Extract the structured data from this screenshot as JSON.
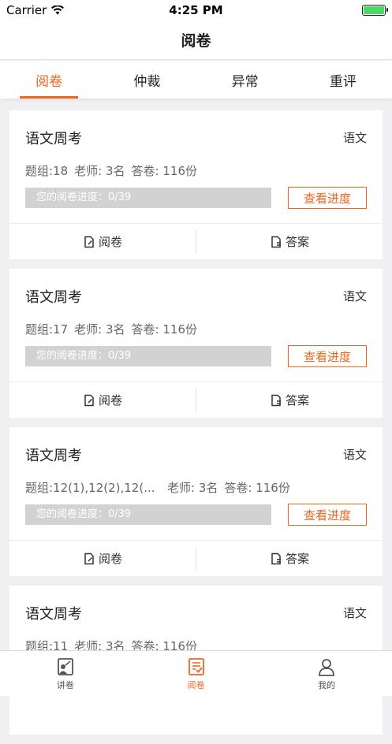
{
  "status": {
    "carrier": "Carrier",
    "time": "4:25 PM"
  },
  "nav": {
    "title": "阅卷"
  },
  "tabs": [
    {
      "label": "阅卷",
      "active": true
    },
    {
      "label": "仲裁",
      "active": false
    },
    {
      "label": "异常",
      "active": false
    },
    {
      "label": "重评",
      "active": false
    }
  ],
  "cards": [
    {
      "title": "语文周考",
      "subject": "语文",
      "group": "题组:18",
      "teachers": "老师: 3名",
      "papers": "答卷: 116份",
      "progress": "您的阅卷进度：0/39",
      "view_label": "查看进度",
      "mark_label": "阅卷",
      "answer_label": "答案"
    },
    {
      "title": "语文周考",
      "subject": "语文",
      "group": "题组:17",
      "teachers": "老师: 3名",
      "papers": "答卷: 116份",
      "progress": "您的阅卷进度：0/39",
      "view_label": "查看进度",
      "mark_label": "阅卷",
      "answer_label": "答案"
    },
    {
      "title": "语文周考",
      "subject": "语文",
      "group": "题组:12(1),12(2),12(...",
      "teachers": "老师: 3名",
      "papers": "答卷: 116份",
      "progress": "您的阅卷进度：0/39",
      "view_label": "查看进度",
      "mark_label": "阅卷",
      "answer_label": "答案"
    },
    {
      "title": "语文周考",
      "subject": "语文",
      "group": "题组:11",
      "teachers": "老师: 3名",
      "papers": "答卷: 116份",
      "progress": "",
      "view_label": "",
      "mark_label": "",
      "answer_label": ""
    }
  ],
  "bottom_tabs": [
    {
      "label": "讲卷",
      "icon": "lecture-icon",
      "active": false
    },
    {
      "label": "阅卷",
      "icon": "marking-icon",
      "active": true
    },
    {
      "label": "我的",
      "icon": "profile-icon",
      "active": false
    }
  ],
  "colors": {
    "accent": "#f0641e",
    "progress_bg": "#d2d2d2"
  }
}
